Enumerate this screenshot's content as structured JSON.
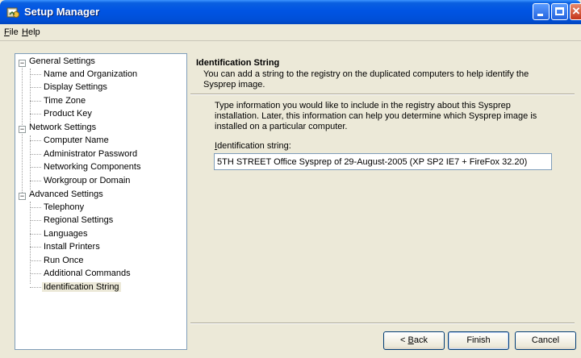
{
  "window": {
    "title": "Setup Manager"
  },
  "menu": [
    {
      "label": "File",
      "accel": "F",
      "rest": "ile"
    },
    {
      "label": "Help",
      "accel": "H",
      "rest": "elp"
    }
  ],
  "tree": {
    "groups": [
      {
        "label": "General Settings",
        "expander": "−",
        "items": [
          "Name and Organization",
          "Display Settings",
          "Time Zone",
          "Product Key"
        ]
      },
      {
        "label": "Network Settings",
        "expander": "−",
        "items": [
          "Computer Name",
          "Administrator Password",
          "Networking Components",
          "Workgroup or Domain"
        ]
      },
      {
        "label": "Advanced Settings",
        "expander": "−",
        "items": [
          "Telephony",
          "Regional Settings",
          "Languages",
          "Install Printers",
          "Run Once",
          "Additional Commands",
          "Identification String"
        ]
      }
    ],
    "selected": "Identification String"
  },
  "page": {
    "title": "Identification String",
    "description": "You can add a string to the registry on the duplicated computers to help identify the Sysprep image.",
    "body": "Type information you would like to include in the registry about this Sysprep installation. Later, this information can help you determine which Sysprep image is installed on a particular computer.",
    "field_label_accel": "I",
    "field_label_rest": "dentification string:",
    "field_value": "5TH STREET Office Sysprep of 29-August-2005 (XP SP2 IE7 + FireFox 32.20)"
  },
  "buttons": {
    "back_prefix": "< ",
    "back_accel": "B",
    "back_rest": "ack",
    "finish": "Finish",
    "cancel": "Cancel"
  },
  "colors": {
    "titlebar": "#0054e3",
    "dialog_bg": "#ece9d8",
    "close_button": "#c4351a"
  }
}
